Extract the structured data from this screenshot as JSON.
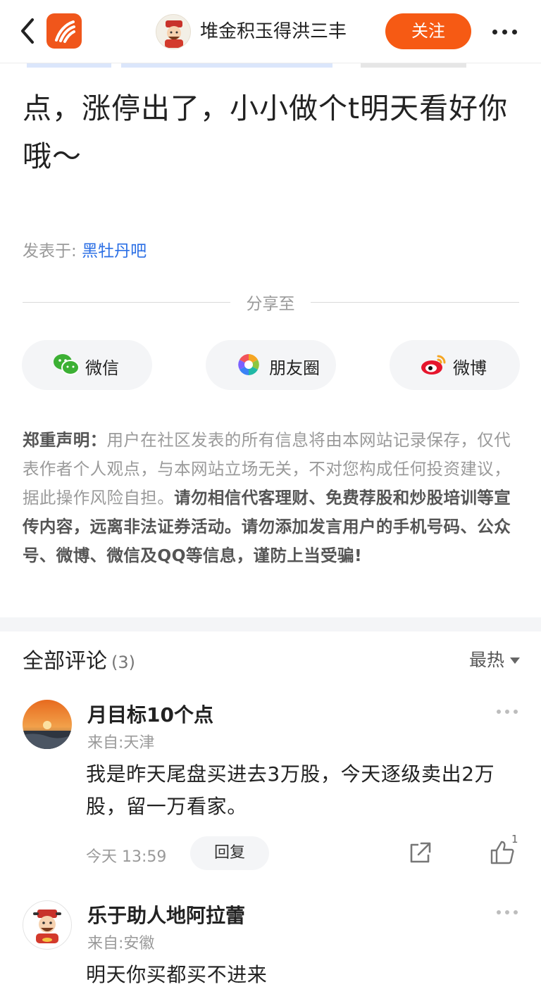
{
  "header": {
    "author_name": "堆金积玉得洪三丰",
    "follow_label": "关注"
  },
  "post": {
    "text": "点，涨停出了，小小做个t明天看好你哦～",
    "posted_in_prefix": "发表于:",
    "posted_in_bar": "黑牡丹吧"
  },
  "share": {
    "title": "分享至",
    "buttons": [
      {
        "label": "微信",
        "icon": "wechat-icon"
      },
      {
        "label": "朋友圈",
        "icon": "moments-icon"
      },
      {
        "label": "微博",
        "icon": "weibo-icon"
      }
    ]
  },
  "disclaimer": {
    "title": "郑重声明：",
    "normal": "用户在社区发表的所有信息将由本网站记录保存，仅代表作者个人观点，与本网站立场无关，不对您构成任何投资建议，据此操作风险自担。",
    "bold": "请勿相信代客理财、免费荐股和炒股培训等宣传内容，远离非法证券活动。请勿添加发言用户的手机号码、公众号、微博、微信及QQ等信息，谨防上当受骗!"
  },
  "comments_section": {
    "title": "全部评论",
    "count": "(3)",
    "sort_label": "最热"
  },
  "comments": [
    {
      "name": "月目标10个点",
      "from": "来自:天津",
      "text": "我是昨天尾盘买进去3万股，今天逐级卖出2万股，留一万看家。",
      "time": "今天 13:59",
      "reply_label": "回复",
      "likes": "1"
    },
    {
      "name": "乐于助人地阿拉蕾",
      "from": "来自:安徽",
      "text": "明天你买都买不进来"
    }
  ],
  "colors": {
    "accent": "#f65a14",
    "link": "#2b6fe5",
    "muted": "#9a9a9a"
  }
}
